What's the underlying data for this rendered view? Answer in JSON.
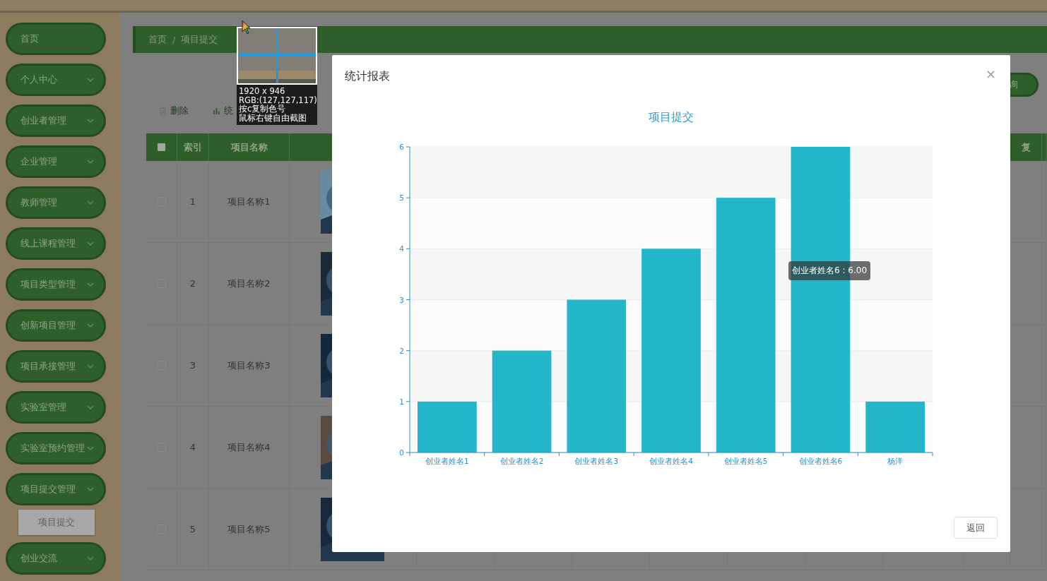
{
  "sidebar": {
    "items": [
      {
        "label": "首页",
        "kind": "link"
      },
      {
        "label": "个人中心",
        "kind": "menu"
      },
      {
        "label": "创业者管理",
        "kind": "menu"
      },
      {
        "label": "企业管理",
        "kind": "menu"
      },
      {
        "label": "教师管理",
        "kind": "menu"
      },
      {
        "label": "线上课程管理",
        "kind": "menu"
      },
      {
        "label": "项目类型管理",
        "kind": "menu"
      },
      {
        "label": "创新项目管理",
        "kind": "menu"
      },
      {
        "label": "项目承接管理",
        "kind": "menu"
      },
      {
        "label": "实验室管理",
        "kind": "menu"
      },
      {
        "label": "实验室预约管理",
        "kind": "menu"
      },
      {
        "label": "项目提交管理",
        "kind": "menu",
        "children": [
          {
            "label": "项目提交"
          }
        ]
      },
      {
        "label": "创业交流",
        "kind": "menu"
      }
    ]
  },
  "breadcrumb": [
    "首页",
    "项目提交"
  ],
  "breadcrumb_separator": "/",
  "search_button": {
    "label": "询"
  },
  "toolbar": [
    {
      "label": "删除",
      "kind": "delete"
    },
    {
      "label": "统",
      "kind": "chart"
    }
  ],
  "table": {
    "columns": [
      {
        "kind": "check",
        "checked": false
      },
      {
        "label": "索引"
      },
      {
        "label": "项目名称"
      },
      {},
      {},
      {},
      {},
      {},
      {},
      {},
      {},
      {},
      {
        "label": "复"
      },
      {}
    ],
    "rows": [
      {
        "index": "1",
        "name": "项目名称1",
        "checked": false
      },
      {
        "index": "2",
        "name": "项目名称2",
        "checked": false
      },
      {
        "index": "3",
        "name": "项目名称3",
        "checked": false
      },
      {
        "index": "4",
        "name": "项目名称4",
        "checked": false
      },
      {
        "index": "5",
        "name": "项目名称5",
        "checked": false
      }
    ]
  },
  "dialog": {
    "title": "统计报表",
    "close": "×",
    "button": "返回",
    "tooltip": {
      "text": "创业者姓名6 : 6.00"
    },
    "chart_data": {
      "type": "bar",
      "title": "项目提交",
      "grid": true,
      "categories": [
        "创业者姓名1",
        "创业者姓名2",
        "创业者姓名3",
        "创业者姓名4",
        "创业者姓名5",
        "创业者姓名6",
        "杨洋"
      ],
      "series": [
        {
          "color": "#23b7c9",
          "values": [
            1,
            2,
            3,
            4,
            5,
            6,
            1
          ]
        }
      ],
      "ylim": [
        0,
        6
      ],
      "yticks": [
        0,
        1,
        2,
        3,
        4,
        5,
        6
      ]
    }
  },
  "capture_tool": {
    "size": "1920 x 946",
    "rgb": "RGB:(127,127,117)",
    "hints": [
      "按c复制色号",
      "鼠标右键自由截图"
    ]
  }
}
